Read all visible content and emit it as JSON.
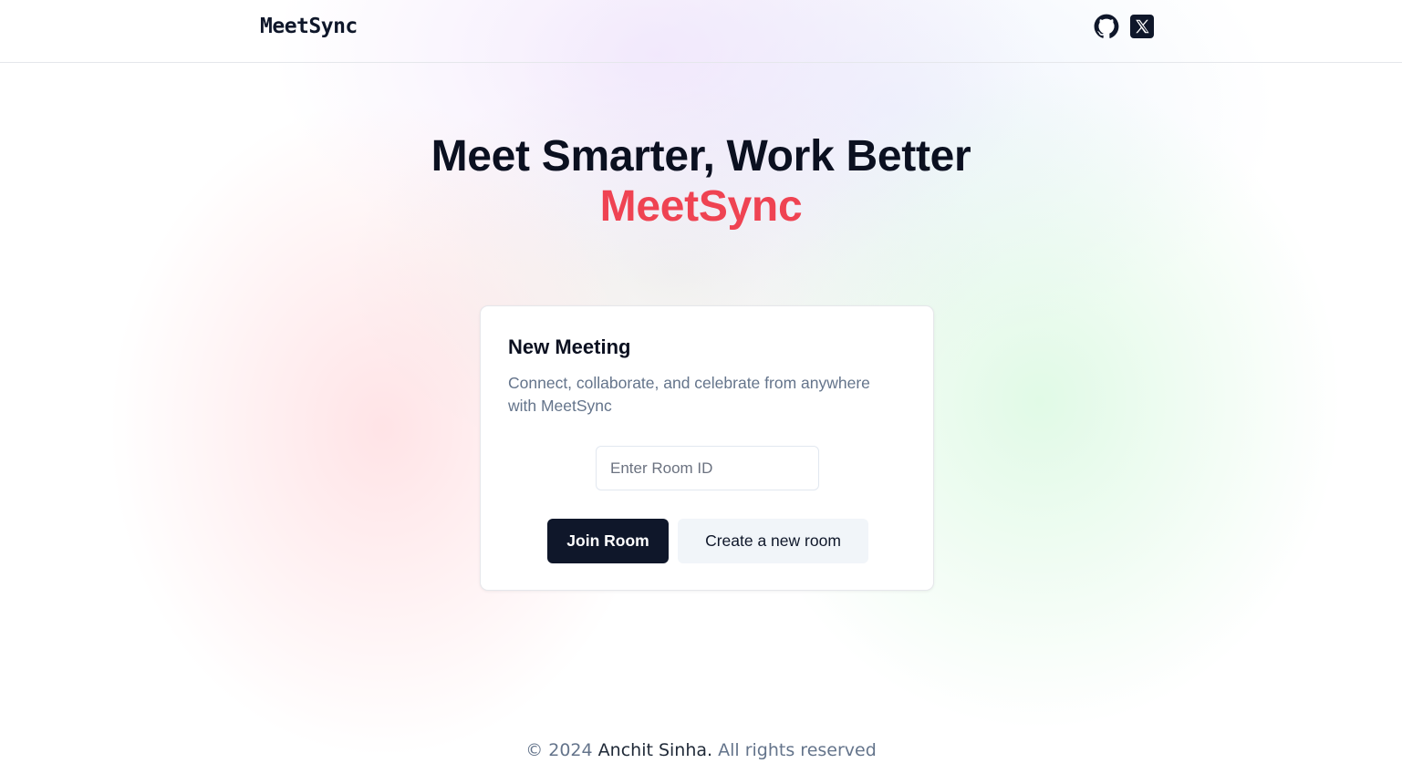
{
  "header": {
    "logo": "MeetSync",
    "links": [
      {
        "icon": "github-icon",
        "label": "GitHub"
      },
      {
        "icon": "x-icon",
        "label": "X"
      }
    ]
  },
  "hero": {
    "line1": "Meet Smarter, Work Better",
    "line2": "MeetSync",
    "accent_color": "#ef4352"
  },
  "card": {
    "title": "New Meeting",
    "description": "Connect, collaborate, and celebrate from anywhere with MeetSync",
    "room_input": {
      "placeholder": "Enter Room ID",
      "value": ""
    },
    "join_label": "Join Room",
    "create_label": "Create a new room"
  },
  "footer": {
    "copyright": "© 2024",
    "author": "Anchit Sinha.",
    "rights": "All rights reserved"
  }
}
